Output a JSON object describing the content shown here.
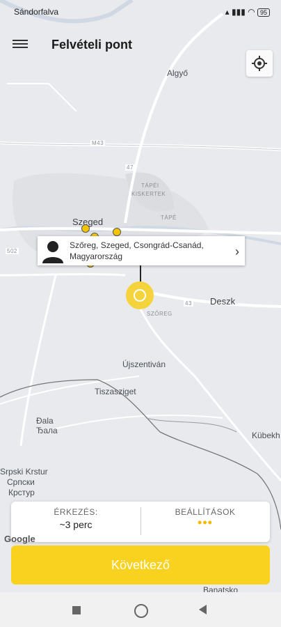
{
  "status": {
    "left": "Sándorfalva",
    "right": "95"
  },
  "header": {
    "title": "Felvételi pont"
  },
  "map": {
    "labels": {
      "algyo": "Algyő",
      "m43": "M43",
      "r47": "47",
      "tapei": "TÁPÉI",
      "kiskertek": "KISKERTEK",
      "tape": "TÁPÉ",
      "szeged": "Szeged",
      "r502": "502",
      "deszk": "Deszk",
      "a43": "43",
      "szoreg": "SZŐREG",
      "ujszentivan": "Újszentiván",
      "tiszasziget": "Tiszasziget",
      "djala": "Đala",
      "djala_cyr": "Ђала",
      "srpski": "Srpski Krstur",
      "srpski_cyr1": "Српски",
      "srpski_cyr2": "Крстур",
      "kubekh": "Kübekh",
      "banatsko": "Banatsko",
      "google": "Google"
    }
  },
  "pickup": {
    "address": "Szőreg, Szeged, Csongrád-Csanád, Magyarország"
  },
  "info": {
    "arrival_label": "ÉRKEZÉS:",
    "arrival_value": "~3 perc",
    "settings_label": "BEÁLLÍTÁSOK",
    "settings_value": "•••"
  },
  "actions": {
    "next_label": "Következő"
  },
  "colors": {
    "accent": "#f8d21f",
    "pin": "#f5d33d"
  },
  "icons": [
    "menu-icon",
    "locate-icon",
    "person-icon",
    "chevron-right-icon",
    "pickup-pin-icon",
    "taxi-icon"
  ]
}
